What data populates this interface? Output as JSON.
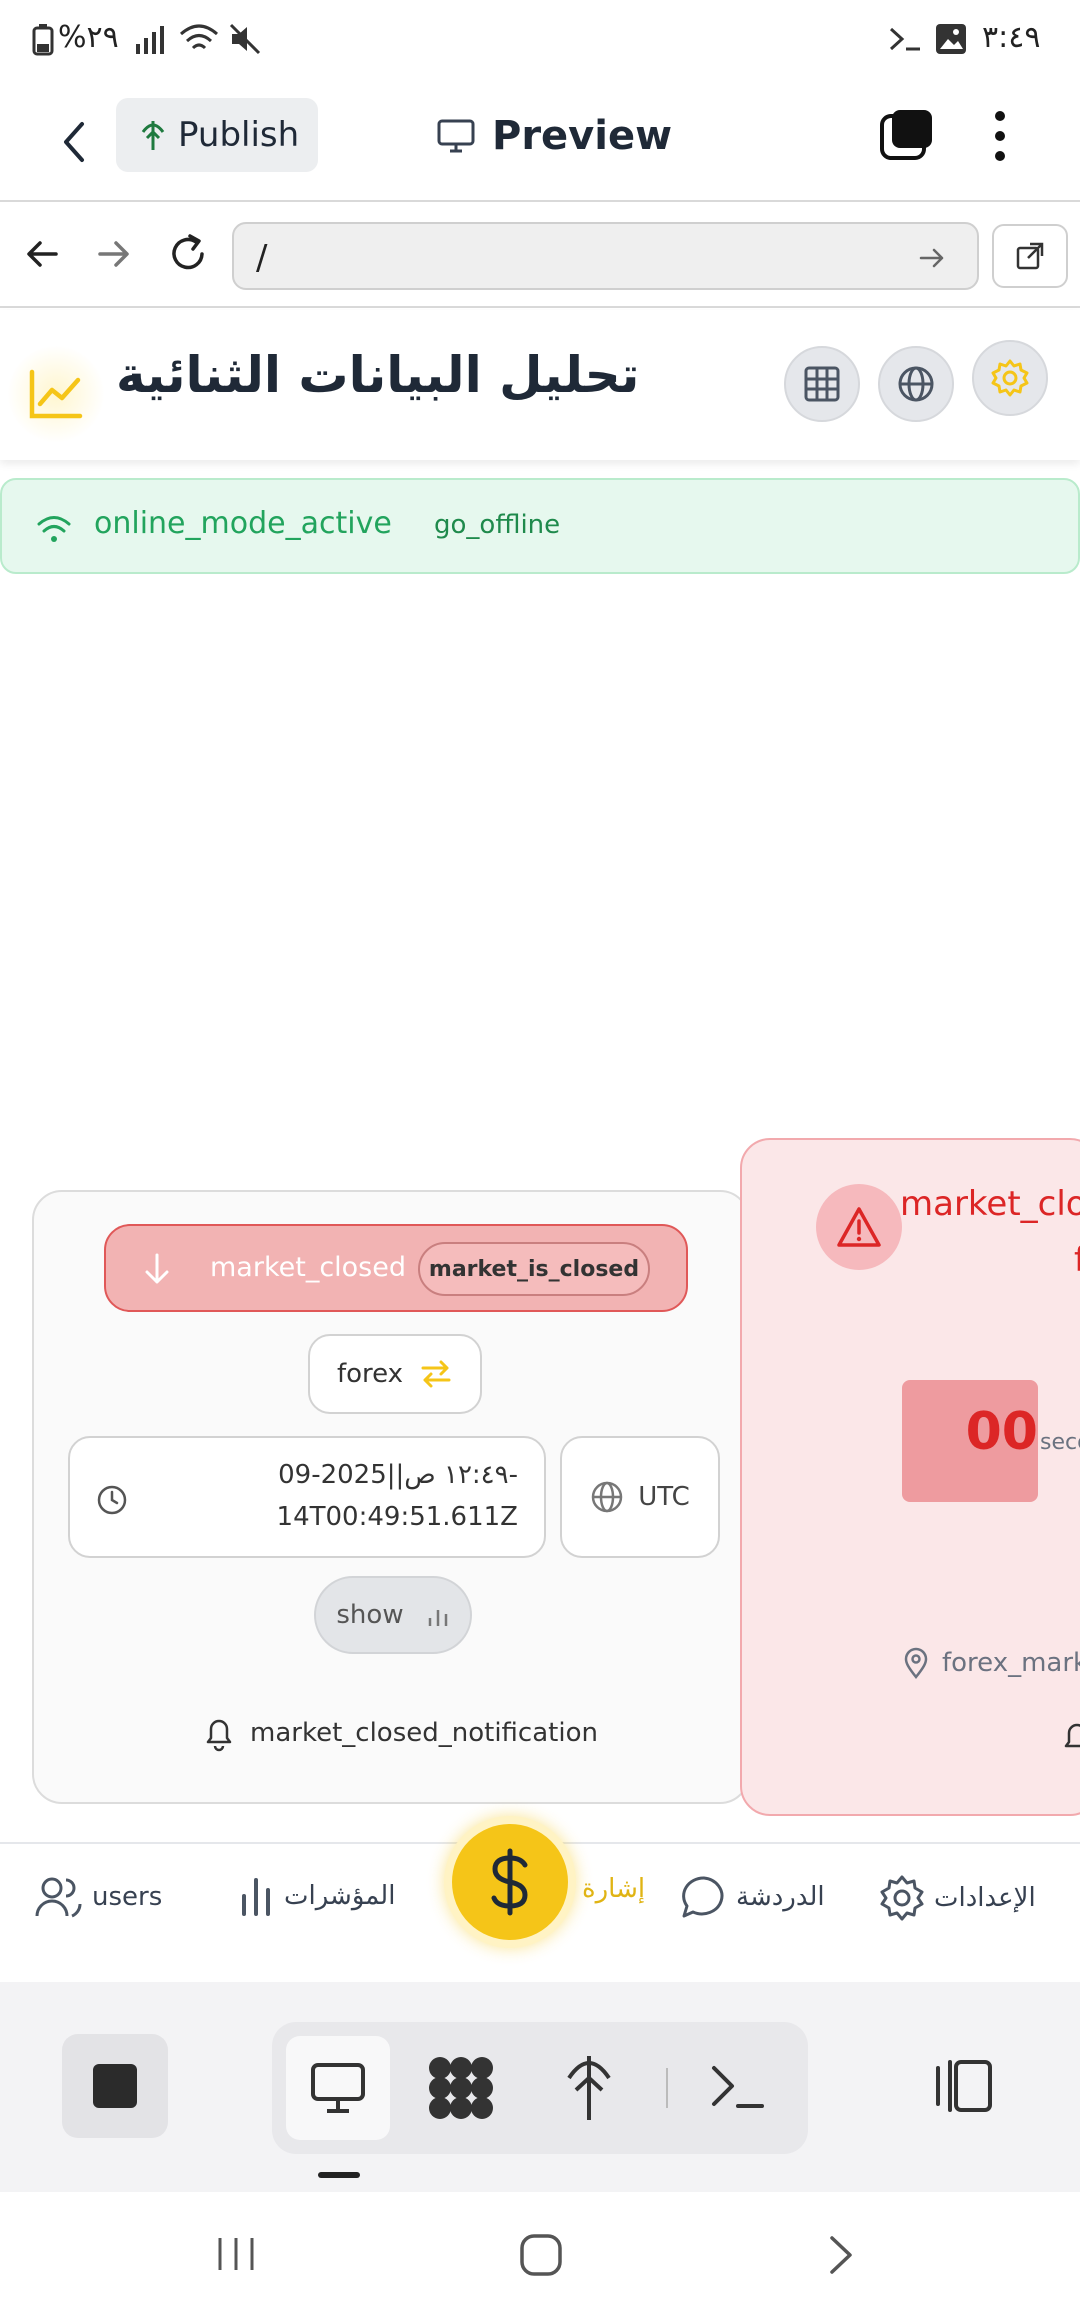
{
  "status_bar": {
    "time": "٣:٤٩",
    "battery": "%٢٩"
  },
  "app_bar": {
    "publish_label": "Publish",
    "preview_label": "Preview"
  },
  "url_bar": {
    "url": "/"
  },
  "header": {
    "title": "تحليل البيانات الثنائية"
  },
  "network": {
    "status": "online_mode_active",
    "action": "go_offline"
  },
  "card": {
    "status_label": "market_closed",
    "status_badge": "market_is_closed",
    "market_type": "forex",
    "time_line1": "١٢:٤٩ ص||2025-09-",
    "time_line2": "14T00:49:51.611Z",
    "timezone": "UTC",
    "show_label": "show",
    "notification": "market_closed_notification"
  },
  "side_card": {
    "title_line1": "market_clo",
    "title_line2": "f",
    "countdown_value": "00",
    "countdown_unit": "seco",
    "location": "forex_marke"
  },
  "bottom_nav": {
    "users": "users",
    "indicators": "المؤشرات",
    "signal": "إشارة",
    "chat": "الدردشة",
    "settings": "الإعدادات"
  },
  "colors": {
    "accent_yellow": "#f5c518",
    "online_green": "#22a45d",
    "closed_red": "#dc2626"
  }
}
